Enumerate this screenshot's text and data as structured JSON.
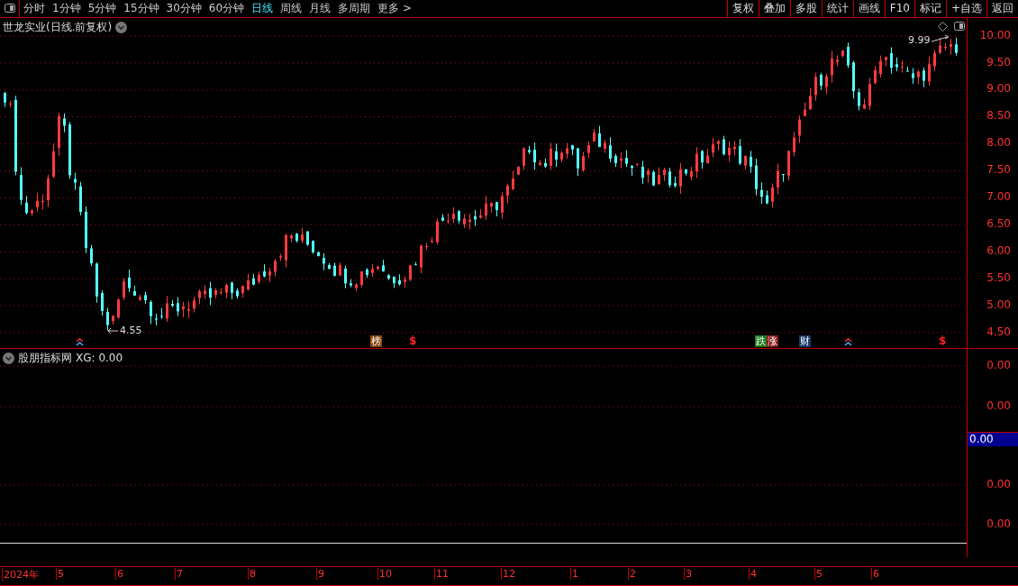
{
  "toolbar": {
    "periods": [
      {
        "label": "分时",
        "selected": false
      },
      {
        "label": "1分钟",
        "selected": false
      },
      {
        "label": "5分钟",
        "selected": false
      },
      {
        "label": "15分钟",
        "selected": false
      },
      {
        "label": "30分钟",
        "selected": false
      },
      {
        "label": "60分钟",
        "selected": false
      },
      {
        "label": "日线",
        "selected": true
      },
      {
        "label": "周线",
        "selected": false
      },
      {
        "label": "月线",
        "selected": false
      },
      {
        "label": "多周期",
        "selected": false
      },
      {
        "label": "更多 >",
        "selected": false
      }
    ],
    "buttons": [
      "复权",
      "叠加",
      "多股",
      "统计",
      "画线",
      "F10",
      "标记",
      "+自选",
      "返回"
    ]
  },
  "main_chart": {
    "title": "世龙实业(日线.前复权)",
    "high_label": "9.99",
    "low_label": "4.55",
    "markers": [
      {
        "kind": "arrow"
      },
      {
        "kind": "badge",
        "text": "榜",
        "color": "#8b4513"
      },
      {
        "kind": "dollar",
        "text": "$"
      },
      {
        "kind": "badge",
        "text": "跌",
        "color": "#1a7a1a"
      },
      {
        "kind": "badge",
        "text": "涨",
        "color": "#8b1a1a"
      },
      {
        "kind": "badge",
        "text": "财",
        "color": "#1a3a6a"
      },
      {
        "kind": "arrow"
      },
      {
        "kind": "dollar",
        "text": "$"
      }
    ],
    "price_ticks": [
      "10.00",
      "9.50",
      "9.00",
      "8.50",
      "8.00",
      "7.50",
      "7.00",
      "6.50",
      "6.00",
      "5.50",
      "5.00",
      "4.50"
    ]
  },
  "indicator": {
    "title": "股朋指标网",
    "reading": "XG: 0.00",
    "ticks": [
      "0.00",
      "0.00",
      "0.00",
      "0.00"
    ],
    "current_value": "0.00"
  },
  "date_axis": [
    "2024年",
    "5",
    "6",
    "7",
    "8",
    "9",
    "10",
    "11",
    "12",
    "1",
    "2",
    "3",
    "4",
    "5",
    "6"
  ]
}
